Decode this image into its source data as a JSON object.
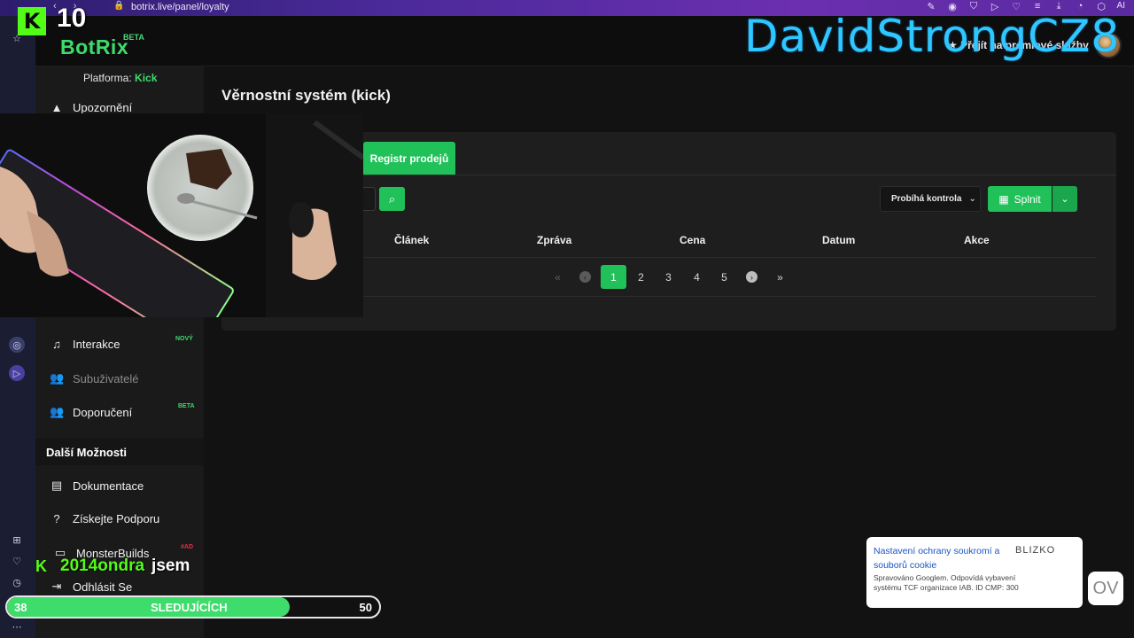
{
  "browser": {
    "url": "botrix.live/panel/loyalty",
    "ai_label": "AI"
  },
  "stream": {
    "kick_count": "10",
    "streamer_name": "DavidStrongCZ8",
    "chat": {
      "user": "2014ondra",
      "message": "jsem"
    },
    "goal": {
      "current": "38",
      "label": "SLEDUJÍCÍCH",
      "target": "50",
      "progress": 0.76
    }
  },
  "header": {
    "logo": "BotRix",
    "logo_badge": "BETA",
    "premium_link": "Přejít na prémiové služby"
  },
  "sidebar": {
    "platform_label": "Platforma:",
    "platform_value": "Kick",
    "items": [
      {
        "label": "Upozornění"
      },
      {
        "label": "Interakce",
        "badge": "NOVÝ"
      },
      {
        "label": "Subuživatelé"
      },
      {
        "label": "Doporučení",
        "badge": "BETA"
      }
    ],
    "section_title": "Další Možnosti",
    "more": [
      {
        "label": "Dokumentace"
      },
      {
        "label": "Získejte Podporu"
      },
      {
        "label": "MonsterBuilds",
        "badge": "#AD"
      },
      {
        "label": "Odhlásit Se"
      }
    ]
  },
  "main": {
    "title": "Věrnostní systém (kick)",
    "active_tab": "Registr prodejů",
    "filter_select": "Probíhá kontrola",
    "action_button": "Splnit",
    "columns": [
      "Článek",
      "Zpráva",
      "Cena",
      "Datum",
      "Akce"
    ],
    "pages": [
      "1",
      "2",
      "3",
      "4",
      "5"
    ]
  },
  "cookie": {
    "title": "Nastavení ochrany soukromí a souborů cookie",
    "brand": "BLIZKO",
    "text": "Spravováno Googlem. Odpovídá vybavení systému TCF organizace IAB. ID CMP: 300",
    "ov": "OV"
  }
}
